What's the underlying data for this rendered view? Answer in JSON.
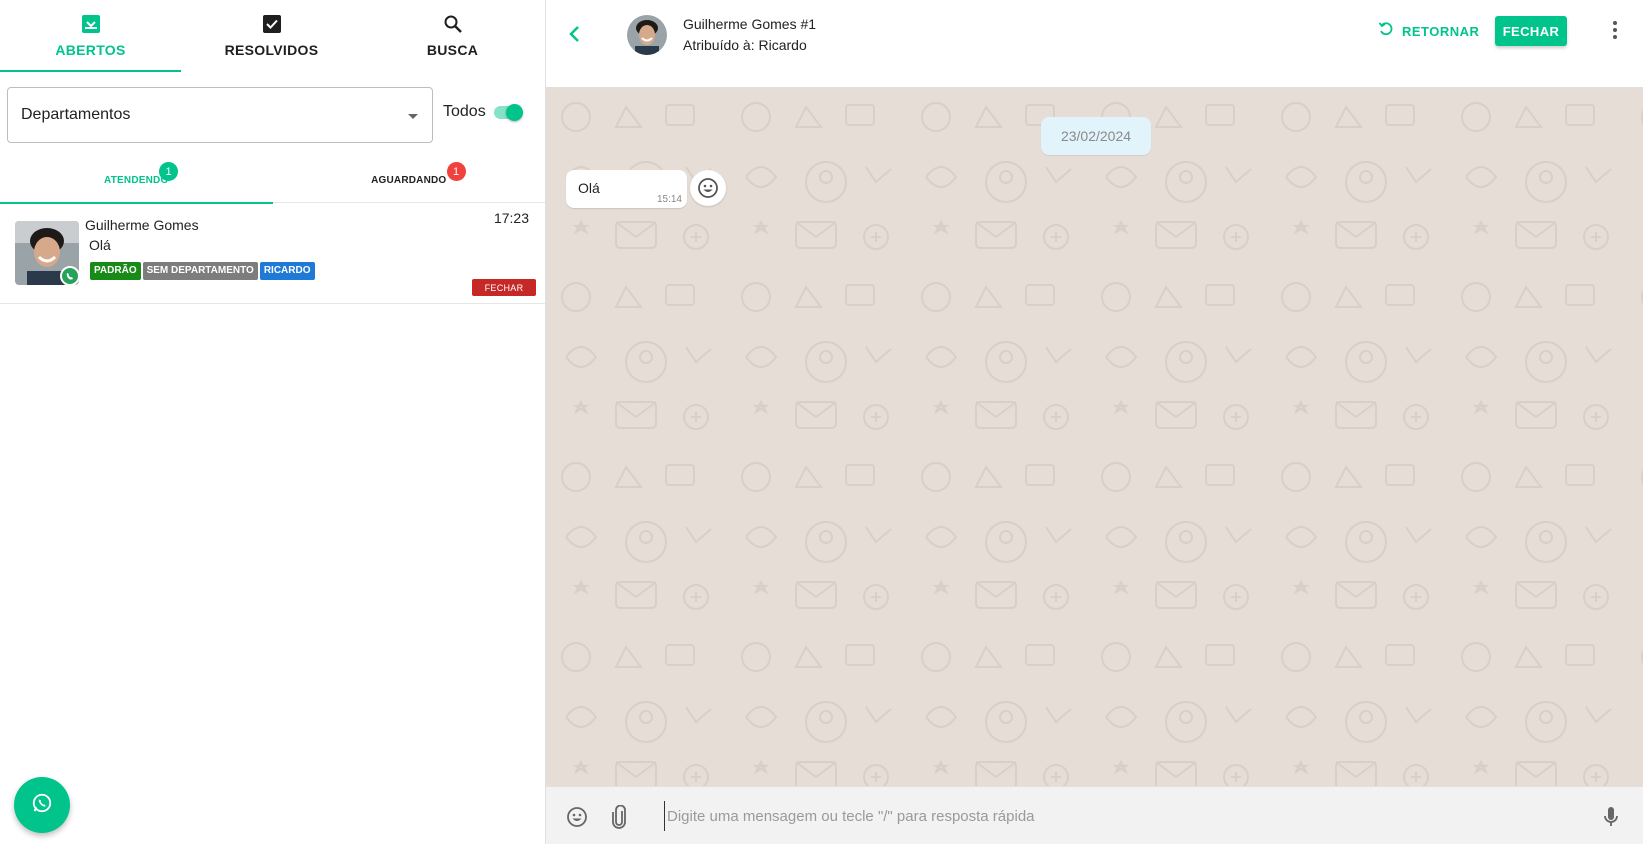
{
  "top_tabs": [
    {
      "label": "ABERTOS",
      "icon": "inbox-icon",
      "active": true
    },
    {
      "label": "RESOLVIDOS",
      "icon": "checkbox-icon",
      "active": false
    },
    {
      "label": "BUSCA",
      "icon": "search-icon",
      "active": false
    }
  ],
  "filters": {
    "department_placeholder": "Departamentos",
    "todos_label": "Todos",
    "todos_enabled": true
  },
  "sub_tabs": [
    {
      "label": "ATENDENDO",
      "count": "1",
      "active": true
    },
    {
      "label": "AGUARDANDO",
      "count": "1",
      "active": false
    }
  ],
  "ticket": {
    "name": "Guilherme Gomes",
    "preview": "Olá",
    "time": "17:23",
    "tags": [
      "PADRÃO",
      "SEM DEPARTAMENTO",
      "RICARDO"
    ],
    "close_label": "FECHAR"
  },
  "chat": {
    "contact_name": "Guilherme Gomes #1",
    "assigned": "Atribuído à: Ricardo",
    "return_label": "RETORNAR",
    "close_label": "FECHAR",
    "date": "23/02/2024",
    "messages": [
      {
        "text": "Olá",
        "time": "15:14"
      }
    ],
    "input_placeholder": "Digite uma mensagem ou tecle \"/\" para resposta rápida"
  },
  "colors": {
    "accent": "#00c48c",
    "danger": "#c62828",
    "badge_red": "#f0413c",
    "chat_bg": "#e6ded6"
  }
}
